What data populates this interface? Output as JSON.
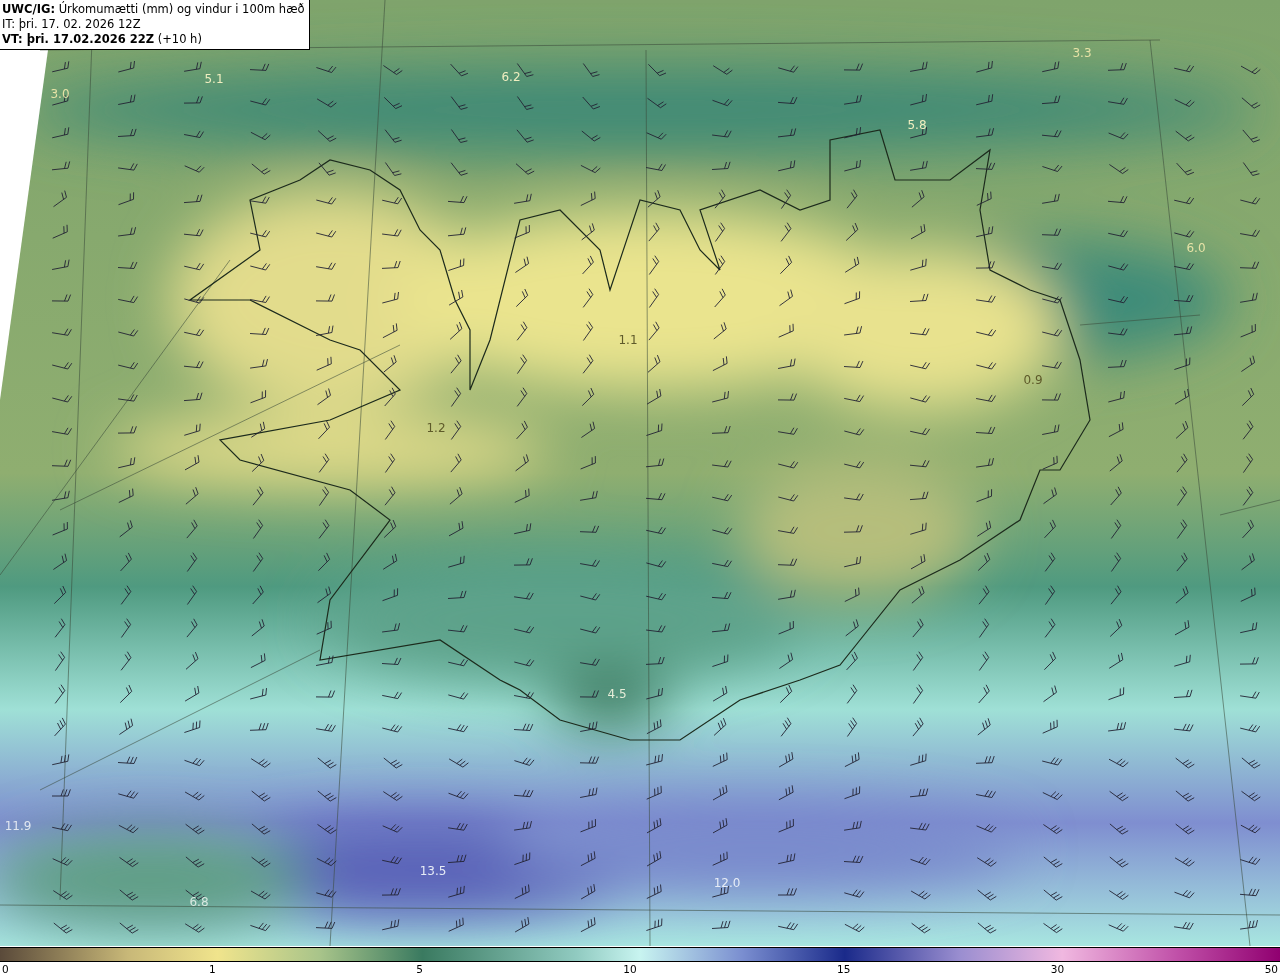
{
  "header": {
    "title": "**UWC/IG:** Úrkomumætti (mm) og vindur i 100m hæð",
    "init_time": "IT: þri. 17. 02. 2026 12Z",
    "valid_time": "**VT: þri. 17.02.2026 22Z** (+10 h)"
  },
  "map_labels": [
    {
      "text": "3.0"
    },
    {
      "text": "5.1"
    },
    {
      "text": "6.2"
    },
    {
      "text": "3.3"
    },
    {
      "text": "5.8"
    },
    {
      "text": "6.0"
    },
    {
      "text": "1.1"
    },
    {
      "text": "1.2"
    },
    {
      "text": "0.9"
    },
    {
      "text": "4.5"
    },
    {
      "text": "11.9"
    },
    {
      "text": "13.5"
    },
    {
      "text": "6.8"
    },
    {
      "text": "12.0"
    }
  ],
  "color_scale": {
    "ticks": [
      "0",
      "1",
      "5",
      "10",
      "15",
      "30",
      "50"
    ]
  }
}
